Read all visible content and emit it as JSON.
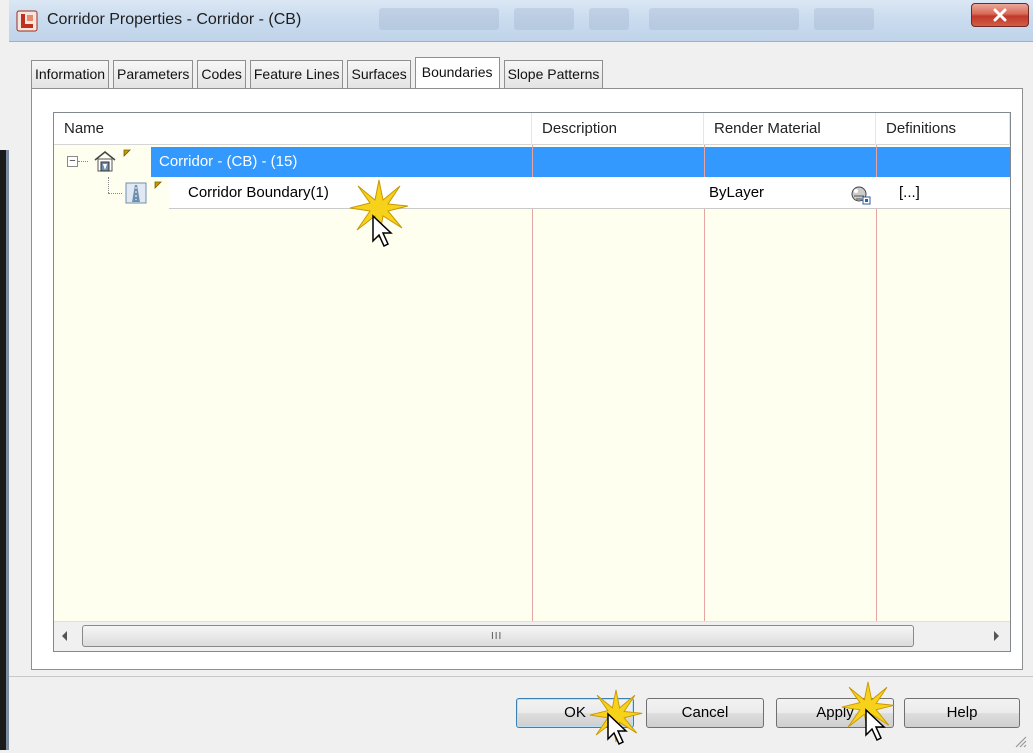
{
  "window": {
    "title": "Corridor Properties - Corridor - (CB)"
  },
  "tabs": [
    {
      "label": "Information"
    },
    {
      "label": "Parameters"
    },
    {
      "label": "Codes"
    },
    {
      "label": "Feature Lines"
    },
    {
      "label": "Surfaces"
    },
    {
      "label": "Boundaries"
    },
    {
      "label": "Slope Patterns"
    }
  ],
  "active_tab": "Boundaries",
  "table": {
    "columns": [
      "Name",
      "Description",
      "Render Material",
      "Definitions"
    ],
    "rows": [
      {
        "name": "Corridor - (CB) - (15)",
        "description": "",
        "render_material": "",
        "definitions": "",
        "selected": true
      },
      {
        "name": "Corridor Boundary(1)",
        "description": "",
        "render_material": "ByLayer",
        "definitions": "[...]",
        "selected": false
      }
    ]
  },
  "scrollbar": {
    "grip": "III"
  },
  "buttons": {
    "ok": "OK",
    "cancel": "Cancel",
    "apply": "Apply",
    "help": "Help"
  },
  "colors": {
    "selection": "#3399ff",
    "grid_background": "#fffff0",
    "column_divider": "#e8a5a5",
    "close_button": "#c0392b"
  }
}
